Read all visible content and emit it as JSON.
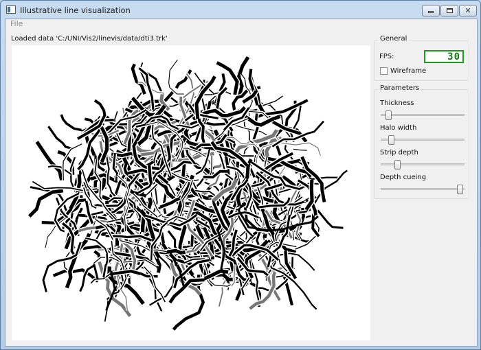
{
  "window": {
    "title": "Illustrative line visualization",
    "controls": {
      "minimize_icon": "minimize-icon",
      "maximize_icon": "restore-icon",
      "close_icon": "close-icon"
    }
  },
  "menu": {
    "items": [
      "File"
    ]
  },
  "status": {
    "loaded_text": "Loaded data 'C:/UNI/Vis2/linevis/data/dti3.trk'"
  },
  "viewport": {
    "content": "illustrative-line-rendering",
    "background": "#ffffff",
    "stroke": "#000000"
  },
  "general": {
    "title": "General",
    "fps_label": "FPS:",
    "fps_value": "30",
    "wireframe_label": "Wireframe",
    "wireframe_checked": false
  },
  "parameters": {
    "title": "Parameters",
    "sliders": [
      {
        "label": "Thickness",
        "value_fraction": 0.06
      },
      {
        "label": "Halo width",
        "value_fraction": 0.1
      },
      {
        "label": "Strip depth",
        "value_fraction": 0.18
      },
      {
        "label": "Depth cueing",
        "value_fraction": 0.98
      }
    ]
  },
  "colors": {
    "lcd": "#137a13",
    "lcd_border": "#1e9a1e",
    "window_frame": "#b9d1ea"
  }
}
